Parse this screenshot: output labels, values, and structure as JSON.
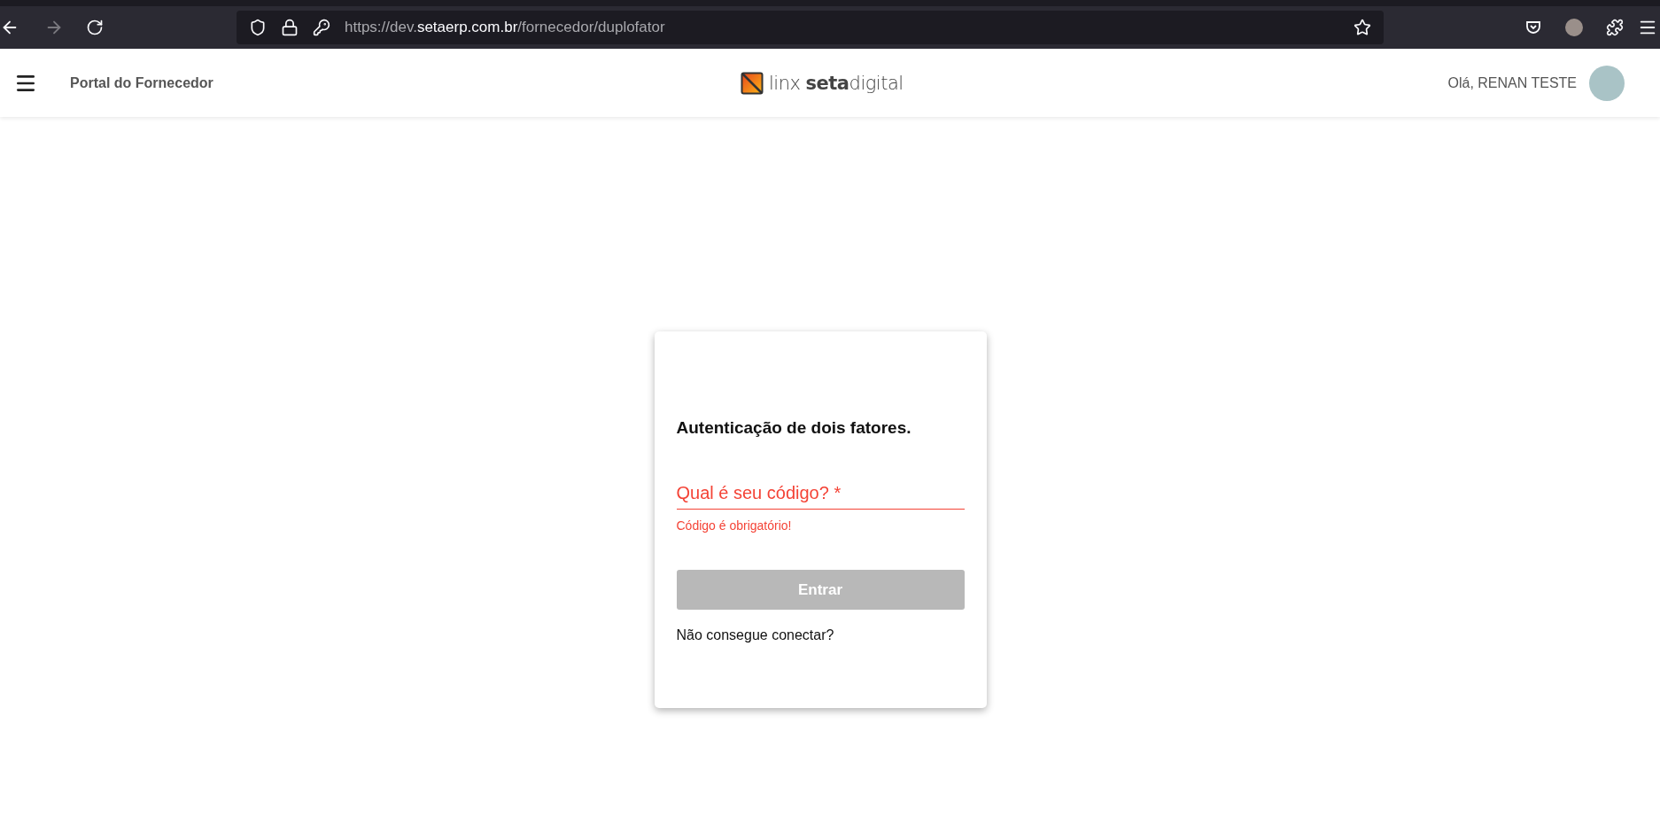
{
  "browser": {
    "back_disabled": false,
    "forward_disabled": true,
    "url": {
      "scheme": "https://dev.",
      "domain": "setaerp.com.br",
      "path": "/fornecedor/duplofator"
    }
  },
  "header": {
    "title": "Portal do Fornecedor",
    "logo": {
      "prefix": "linx ",
      "bold": "seta",
      "suffix": "digital"
    },
    "greeting": "Olá, RENAN TESTE"
  },
  "card": {
    "title": "Autenticação de dois fatores.",
    "field": {
      "label": "Qual é seu código? *",
      "error": true,
      "error_text": "Código é obrigatório!"
    },
    "button": {
      "label": "Entrar",
      "disabled": true
    },
    "link": "Não consegue conectar?"
  }
}
